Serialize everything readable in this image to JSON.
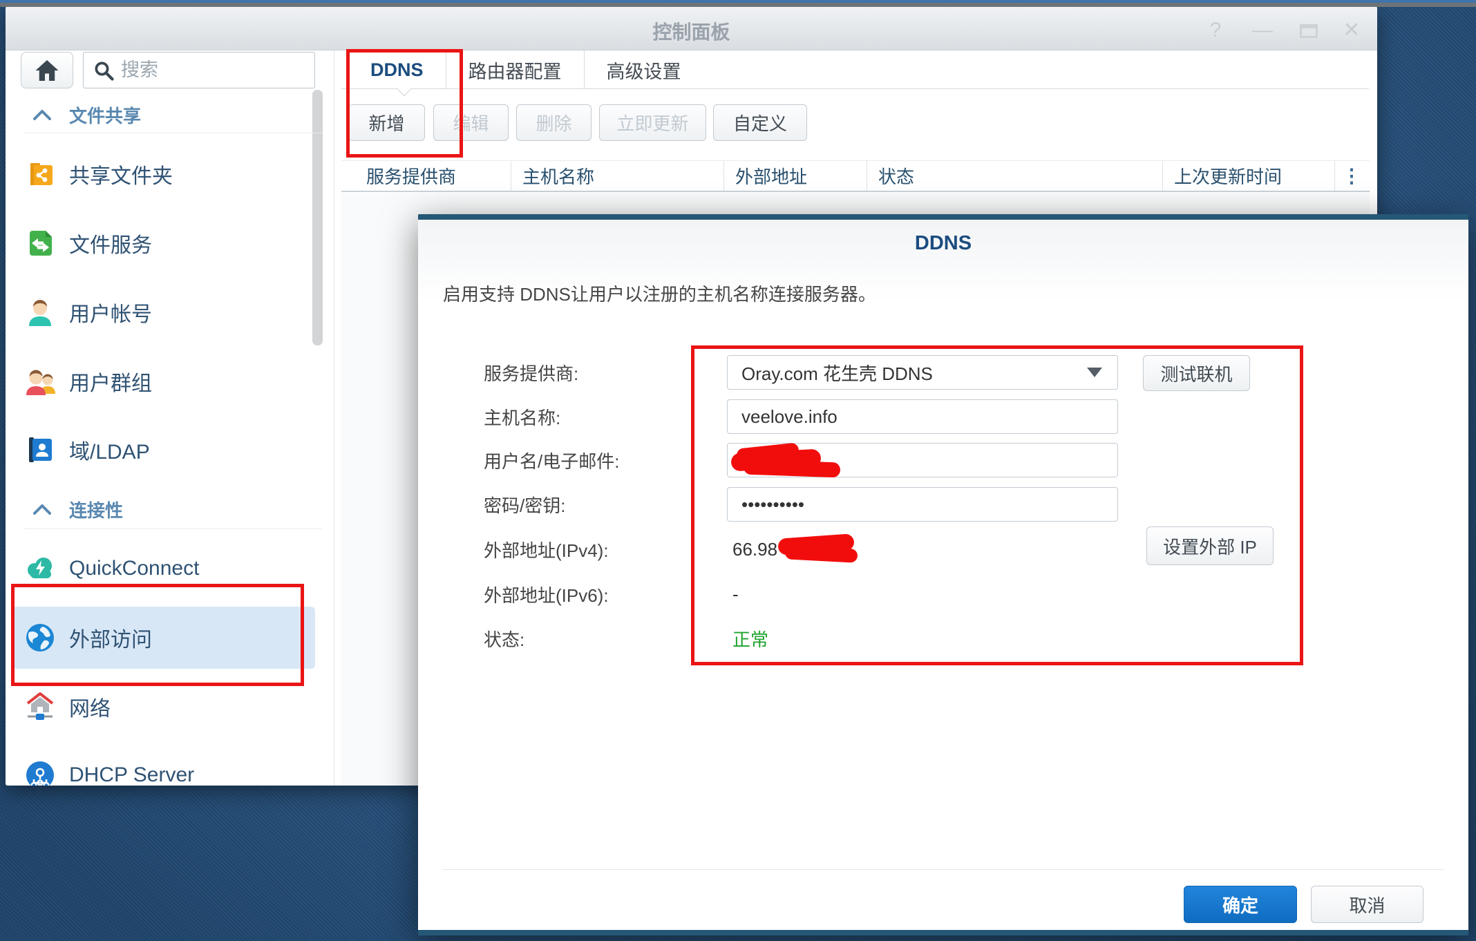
{
  "window": {
    "title": "控制面板",
    "controls": {
      "help": "?",
      "minimize": "—",
      "close": "✕"
    },
    "sidebar": {
      "search_placeholder": "搜索",
      "sections": [
        {
          "label": "文件共享",
          "items": [
            {
              "label": "共享文件夹",
              "icon": "shared-folder"
            },
            {
              "label": "文件服务",
              "icon": "file-services"
            },
            {
              "label": "用户帐号",
              "icon": "user-account"
            },
            {
              "label": "用户群组",
              "icon": "user-group"
            },
            {
              "label": "域/LDAP",
              "icon": "domain-ldap"
            }
          ]
        },
        {
          "label": "连接性",
          "items": [
            {
              "label": "QuickConnect",
              "icon": "quickconnect"
            },
            {
              "label": "外部访问",
              "icon": "external-access",
              "selected": true
            },
            {
              "label": "网络",
              "icon": "network"
            },
            {
              "label": "DHCP Server",
              "icon": "dhcp-server"
            }
          ]
        }
      ]
    },
    "tabs": [
      {
        "label": "DDNS",
        "active": true
      },
      {
        "label": "路由器配置",
        "active": false
      },
      {
        "label": "高级设置",
        "active": false
      }
    ],
    "toolbar": [
      {
        "label": "新增",
        "enabled": true
      },
      {
        "label": "编辑",
        "enabled": false
      },
      {
        "label": "删除",
        "enabled": false
      },
      {
        "label": "立即更新",
        "enabled": false
      },
      {
        "label": "自定义",
        "enabled": true
      }
    ],
    "table": {
      "columns": [
        "服务提供商",
        "主机名称",
        "外部地址",
        "状态",
        "上次更新时间"
      ],
      "menu_icon": "⋮",
      "rows": []
    }
  },
  "dialog": {
    "title": "DDNS",
    "description": "启用支持 DDNS让用户以注册的主机名称连接服务器。",
    "fields": [
      {
        "label": "服务提供商:",
        "type": "select",
        "value": "Oray.com 花生壳 DDNS",
        "button": "测试联机"
      },
      {
        "label": "主机名称:",
        "type": "text",
        "value": "veelove.info"
      },
      {
        "label": "用户名/电子邮件:",
        "type": "text",
        "value": "",
        "redacted": true
      },
      {
        "label": "密码/密钥:",
        "type": "password",
        "value": "••••••••••"
      },
      {
        "label": "外部地址(IPv4):",
        "type": "static",
        "value": "66.98",
        "redacted": true,
        "button": "设置外部 IP"
      },
      {
        "label": "外部地址(IPv6):",
        "type": "static",
        "value": "-"
      },
      {
        "label": "状态:",
        "type": "status",
        "value": "正常"
      }
    ],
    "ok_label": "确定",
    "cancel_label": "取消"
  },
  "colors": {
    "desktop_blue": "#2d6196",
    "dialog_edge_blue": "#255876",
    "active_tab_blue": "#1b4c7e",
    "section_header_blue": "#5988b0",
    "selected_item_bg": "#d8e7f6",
    "primary_button_blue": "#1473cc",
    "status_green": "#1fa32e",
    "annotation_red": "#ea1515"
  }
}
